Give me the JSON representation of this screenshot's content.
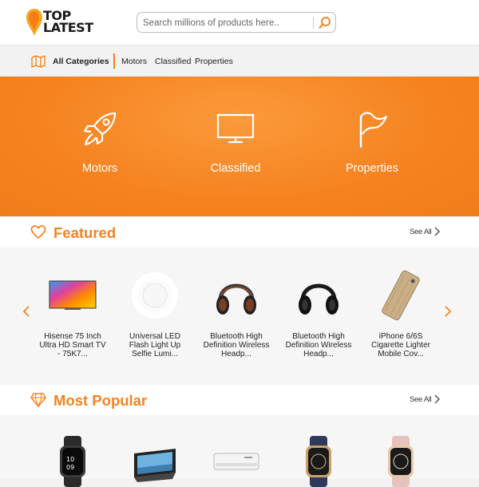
{
  "brand": {
    "line1": "TOP",
    "line2": "LATEST",
    "accent": "#f5821f"
  },
  "search": {
    "placeholder": "Search millions of products here..",
    "value": "",
    "icon": "search-icon"
  },
  "catbar": {
    "all_label": "All Categories",
    "links": [
      "Motors",
      "Classified",
      "Properties"
    ]
  },
  "banner": {
    "items": [
      {
        "label": "Motors",
        "icon": "rocket-icon"
      },
      {
        "label": "Classified",
        "icon": "monitor-icon"
      },
      {
        "label": "Properties",
        "icon": "flag-icon"
      }
    ]
  },
  "featured": {
    "title": "Featured",
    "see_all": "See All",
    "icon": "heart-icon",
    "products": [
      {
        "name_lines": [
          "Hisense 75 Inch",
          "Ultra HD Smart TV",
          "- 75K7..."
        ],
        "image": "tv"
      },
      {
        "name_lines": [
          "Universal LED",
          "Flash Light Up",
          "Selfie Lumi..."
        ],
        "image": "ring-light"
      },
      {
        "name_lines": [
          "Bluetooth High",
          "Definition Wireless",
          "Headp..."
        ],
        "image": "headphones-wood"
      },
      {
        "name_lines": [
          "Bluetooth High",
          "Definition Wireless",
          "Headp..."
        ],
        "image": "headphones-black"
      },
      {
        "name_lines": [
          "iPhone 6/6S",
          "Cigarette Lighter",
          "Mobile Cov..."
        ],
        "image": "phone-case"
      }
    ]
  },
  "popular": {
    "title": "Most Popular",
    "see_all": "See All",
    "icon": "diamond-icon",
    "products": [
      {
        "image": "watch-black"
      },
      {
        "image": "tablet"
      },
      {
        "image": "air-conditioner"
      },
      {
        "image": "watch-navy"
      },
      {
        "image": "watch-pink"
      }
    ]
  }
}
